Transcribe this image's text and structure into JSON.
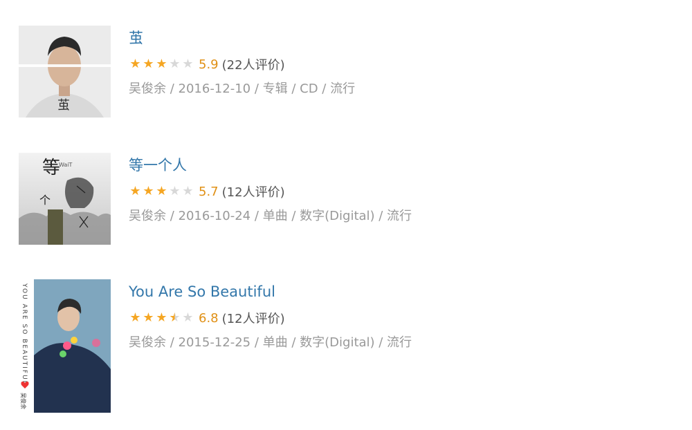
{
  "albums": [
    {
      "title": "茧",
      "cover_text": "茧",
      "rating": 5.9,
      "stars": [
        "full",
        "full",
        "full",
        "empty",
        "empty"
      ],
      "score": "5.9",
      "votes": "(22人评价)",
      "meta": "吴俊余 / 2016-12-10 / 专辑 / CD / 流行"
    },
    {
      "title": "等一个人",
      "cover_text_1": "等",
      "cover_text_2": "一",
      "cover_text_3": "个",
      "cover_text_4": "人",
      "cover_wait": "WaiT",
      "rating": 5.7,
      "stars": [
        "full",
        "full",
        "full",
        "empty",
        "empty"
      ],
      "score": "5.7",
      "votes": "(12人评价)",
      "meta": "吴俊余 / 2016-10-24 / 单曲 / 数字(Digital) / 流行"
    },
    {
      "title": "You Are So Beautiful",
      "cover_text": "YOU ARE SO BEAUTIFUL",
      "cover_artist": "吴俊余",
      "rating": 6.8,
      "stars": [
        "full",
        "full",
        "full",
        "half",
        "empty"
      ],
      "score": "6.8",
      "votes": "(12人评价)",
      "meta": "吴俊余 / 2015-12-25 / 单曲 / 数字(Digital) / 流行"
    }
  ],
  "colors": {
    "link": "#3377aa",
    "star": "#f5a623",
    "score": "#e09015",
    "meta": "#999999"
  },
  "icons": {
    "star_full": "star-full-icon",
    "star_half": "star-half-icon",
    "star_empty": "star-empty-icon"
  }
}
